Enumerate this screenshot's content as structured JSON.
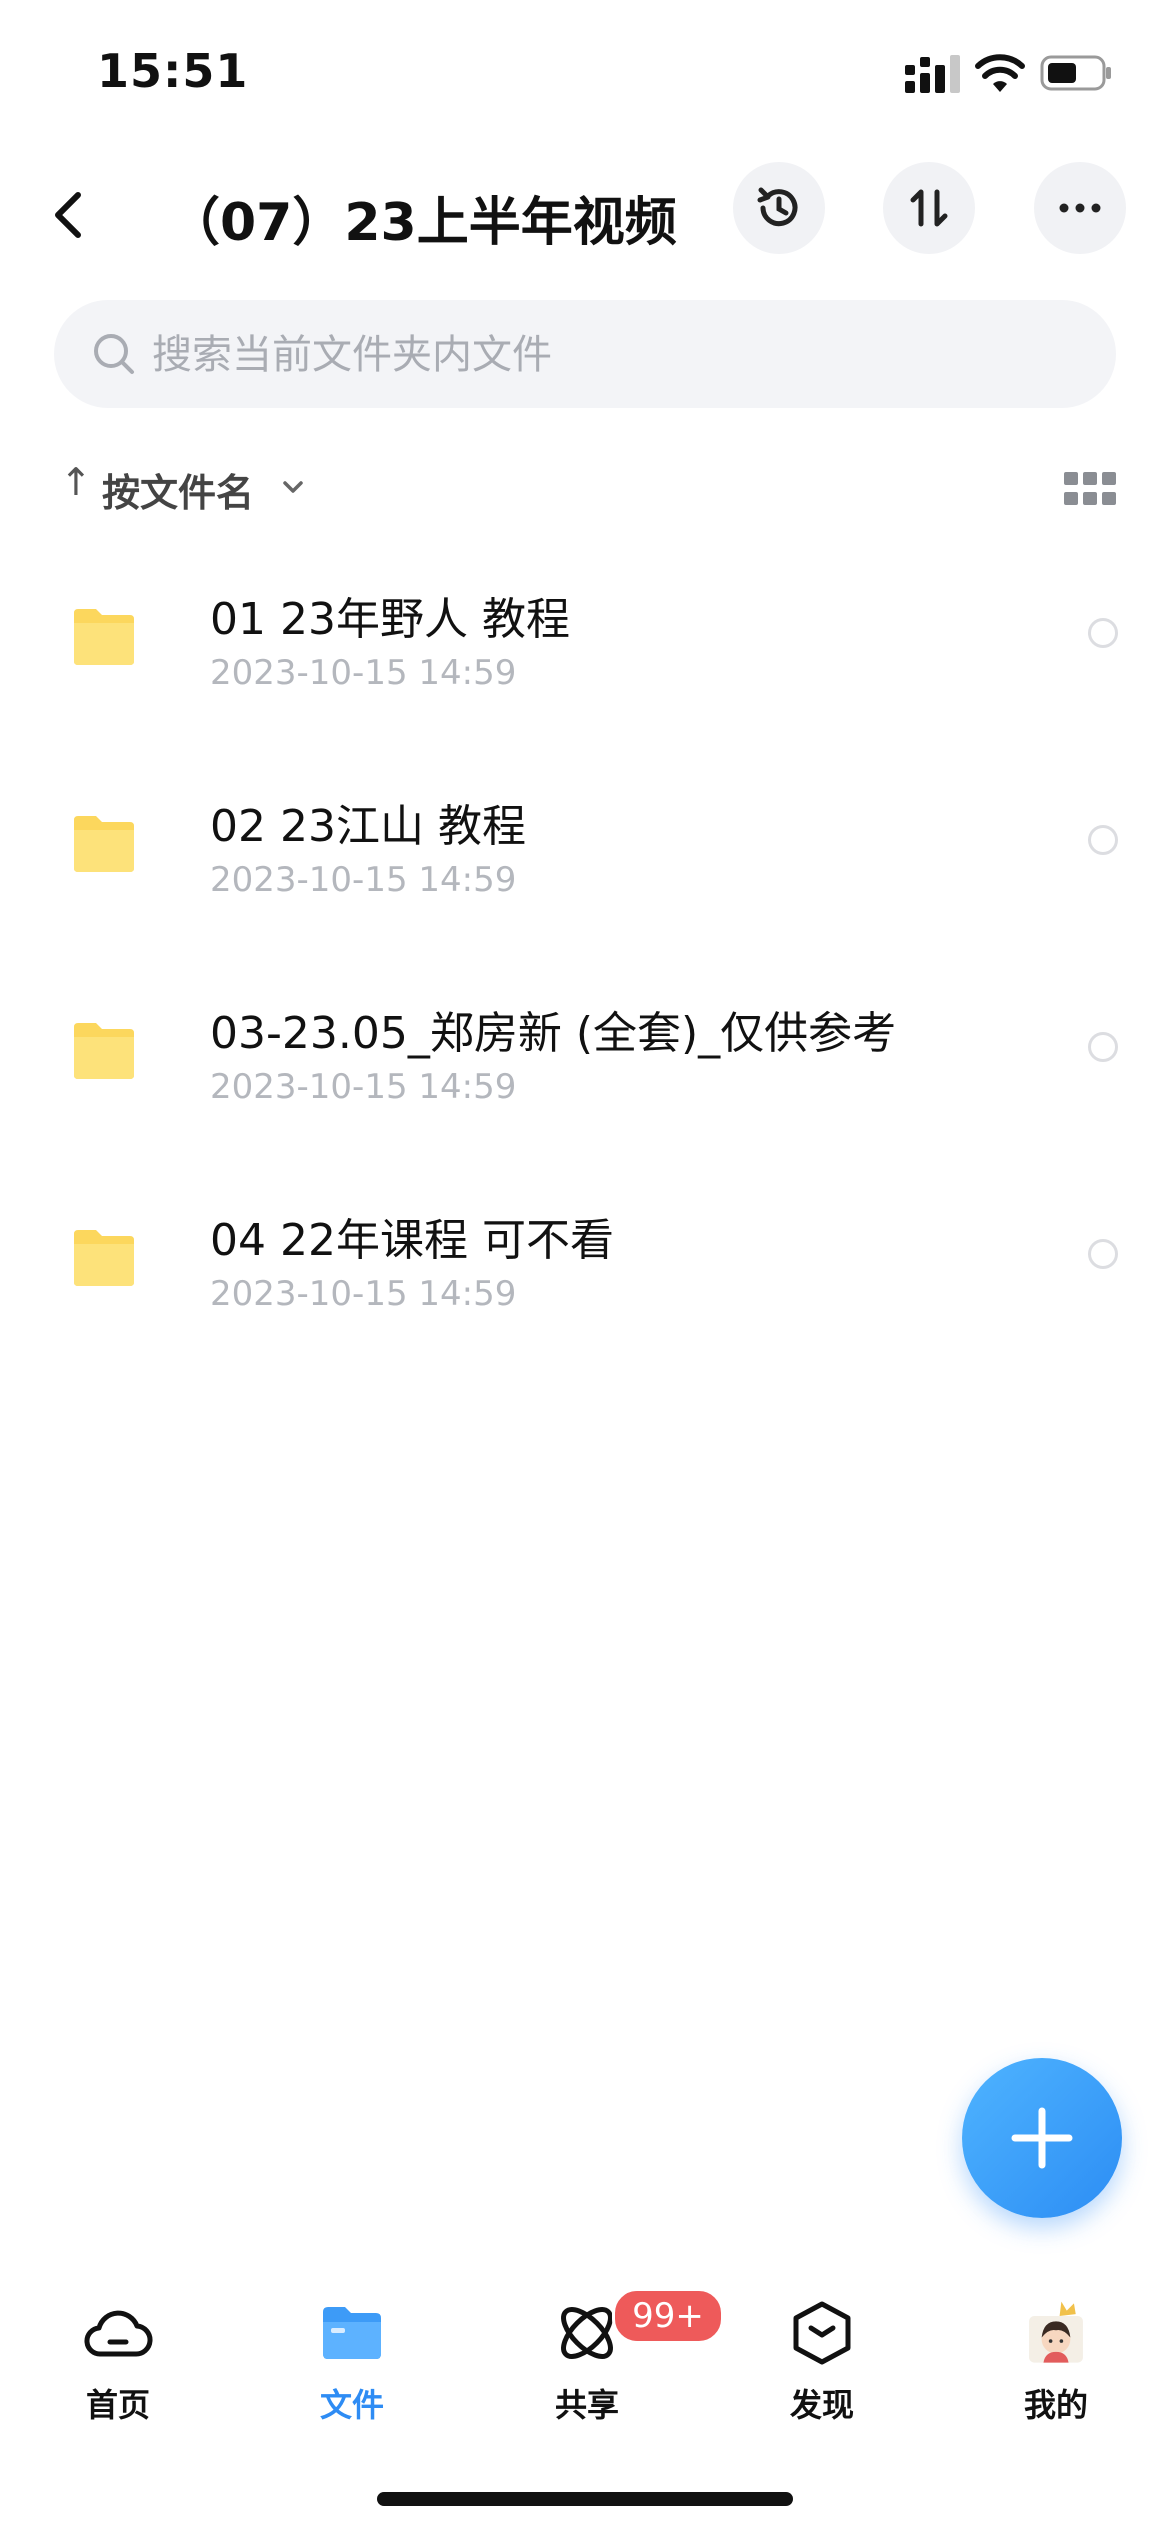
{
  "status_bar": {
    "time": "15:51"
  },
  "header": {
    "title": "（07）23上半年视频"
  },
  "search": {
    "placeholder": "搜索当前文件夹内文件"
  },
  "sort": {
    "arrow": "↑",
    "label": "按文件名"
  },
  "files": [
    {
      "name": "01 23年野人 教程",
      "date": "2023-10-15 14:59"
    },
    {
      "name": "02 23江山 教程",
      "date": "2023-10-15 14:59"
    },
    {
      "name": "03-23.05_郑房新 (全套)_仅供参考",
      "date": "2023-10-15 14:59"
    },
    {
      "name": "04 22年课程 可不看",
      "date": "2023-10-15 14:59"
    }
  ],
  "tabs": [
    {
      "label": "首页",
      "icon": "cloud-icon"
    },
    {
      "label": "文件",
      "icon": "folder-icon",
      "active": true
    },
    {
      "label": "共享",
      "icon": "orbit-icon",
      "badge": "99+"
    },
    {
      "label": "发现",
      "icon": "cube-icon"
    },
    {
      "label": "我的",
      "icon": "avatar"
    }
  ],
  "colors": {
    "accent": "#2e8cf4",
    "folder": "#fcd75d",
    "badge": "#ee5a5a"
  }
}
